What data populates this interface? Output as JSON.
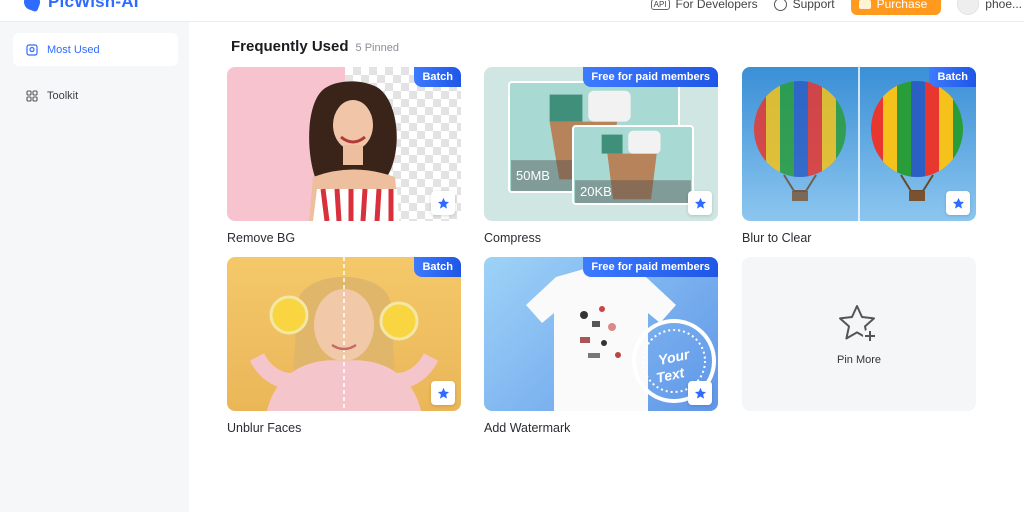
{
  "header": {
    "brand": "PicWish-AI",
    "api_badge": "API",
    "developers_label": "For Developers",
    "support_label": "Support",
    "purchase_label": "Purchase",
    "user_name": "phoe..."
  },
  "sidebar": {
    "items": [
      {
        "label": "Most Used",
        "active": true
      },
      {
        "label": "Toolkit",
        "active": false
      }
    ]
  },
  "main": {
    "title": "Frequently Used",
    "pinned_count": "5 Pinned",
    "tools": [
      {
        "label": "Remove BG",
        "tag": "Batch"
      },
      {
        "label": "Compress",
        "tag": "Free for paid members",
        "size_before": "50MB",
        "size_after": "20KB"
      },
      {
        "label": "Blur to Clear",
        "tag": "Batch"
      },
      {
        "label": "Unblur Faces",
        "tag": "Batch"
      },
      {
        "label": "Add Watermark",
        "tag": "Free for paid members",
        "stamp_line1": "Your",
        "stamp_line2": "Text"
      }
    ],
    "pin_more_label": "Pin More"
  },
  "colors": {
    "accent": "#2f6bff",
    "purchase": "#ff9a1f",
    "sidebar_bg": "#f6f7f9"
  }
}
